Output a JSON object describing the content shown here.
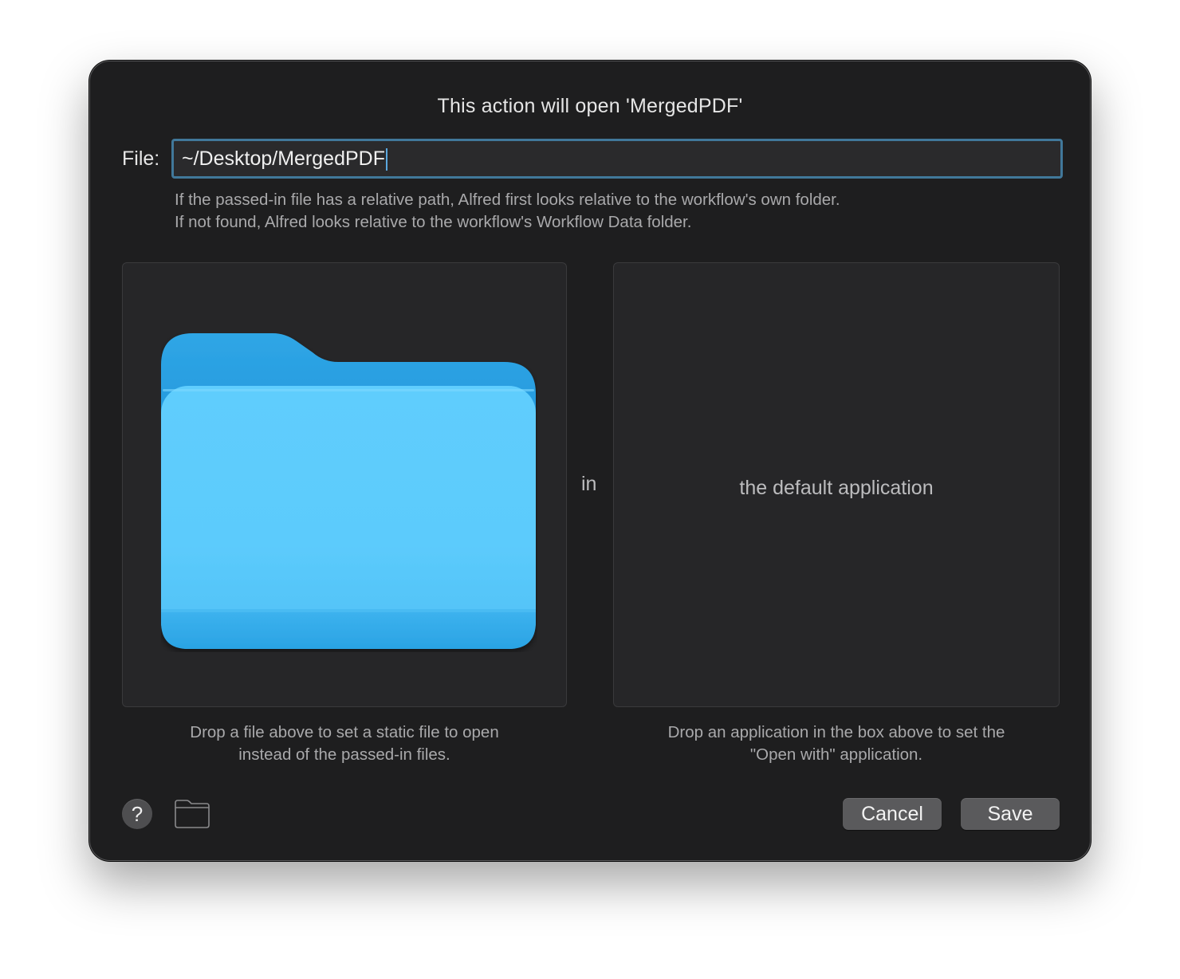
{
  "dialog": {
    "title": "This action will open 'MergedPDF'"
  },
  "file_field": {
    "label": "File:",
    "value": "~/Desktop/MergedPDF"
  },
  "help_text": {
    "line1": "If the passed-in file has a relative path, Alfred first looks relative to the workflow's own folder.",
    "line2": "If not found, Alfred looks relative to the workflow's Workflow Data folder."
  },
  "file_drop": {
    "icon": "folder-icon",
    "caption_line1": "Drop a file above to set a static file to open",
    "caption_line2": "instead of the passed-in files."
  },
  "connector": {
    "label": "in"
  },
  "app_drop": {
    "label": "the default application",
    "caption_line1": "Drop an application in the box above to set the",
    "caption_line2": "\"Open with\" application."
  },
  "footer": {
    "help_label": "?",
    "folder_icon": "folder-outline-icon",
    "cancel_label": "Cancel",
    "save_label": "Save"
  },
  "colors": {
    "dialog_background": "#1e1e1f",
    "input_focus_ring": "#41789a",
    "folder_blue": "#5bc8fb",
    "button_gray": "#5a5a5c"
  }
}
